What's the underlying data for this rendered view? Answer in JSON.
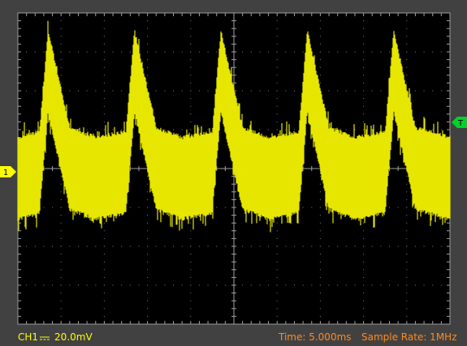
{
  "colors": {
    "frame": "#414141",
    "screen": "#000000",
    "grid": "#7f7f7f",
    "trace": "#e6e600",
    "ch1_marker": "#ffff00",
    "trigger_marker": "#00d22a",
    "status_text_channel": "#ffff00",
    "status_text_time": "#ff8a1e"
  },
  "markers": {
    "channel": "1",
    "trigger": "T"
  },
  "status": {
    "channel": "CH1",
    "coupling_icon": "dc-coupling-icon",
    "volts_per_div": "20.0mV",
    "time_label": "Time: 5.000ms",
    "sample_rate_label": "Sample Rate: 1MHz"
  },
  "chart_data": {
    "type": "line",
    "description_values": {
      "time_per_div_ms": 5,
      "volts_per_div_mV": 20,
      "divisions_x": 10,
      "divisions_y": 8
    },
    "series": [
      {
        "name": "CH1",
        "x_ms": [
          0,
          2.5,
          3.5,
          6.0,
          9.0,
          12.5,
          13.5,
          16.0,
          19.0,
          22.5,
          23.5,
          26.0,
          29.0,
          32.5,
          33.5,
          36.0,
          39.0,
          42.5,
          43.5,
          46.0,
          50.0
        ],
        "y_mV": [
          -5,
          -2,
          50,
          0,
          -5,
          -2,
          50,
          0,
          -5,
          -2,
          50,
          0,
          -5,
          -2,
          50,
          0,
          -5,
          -2,
          50,
          0,
          -5
        ],
        "noise_band_mV": 20
      }
    ]
  }
}
